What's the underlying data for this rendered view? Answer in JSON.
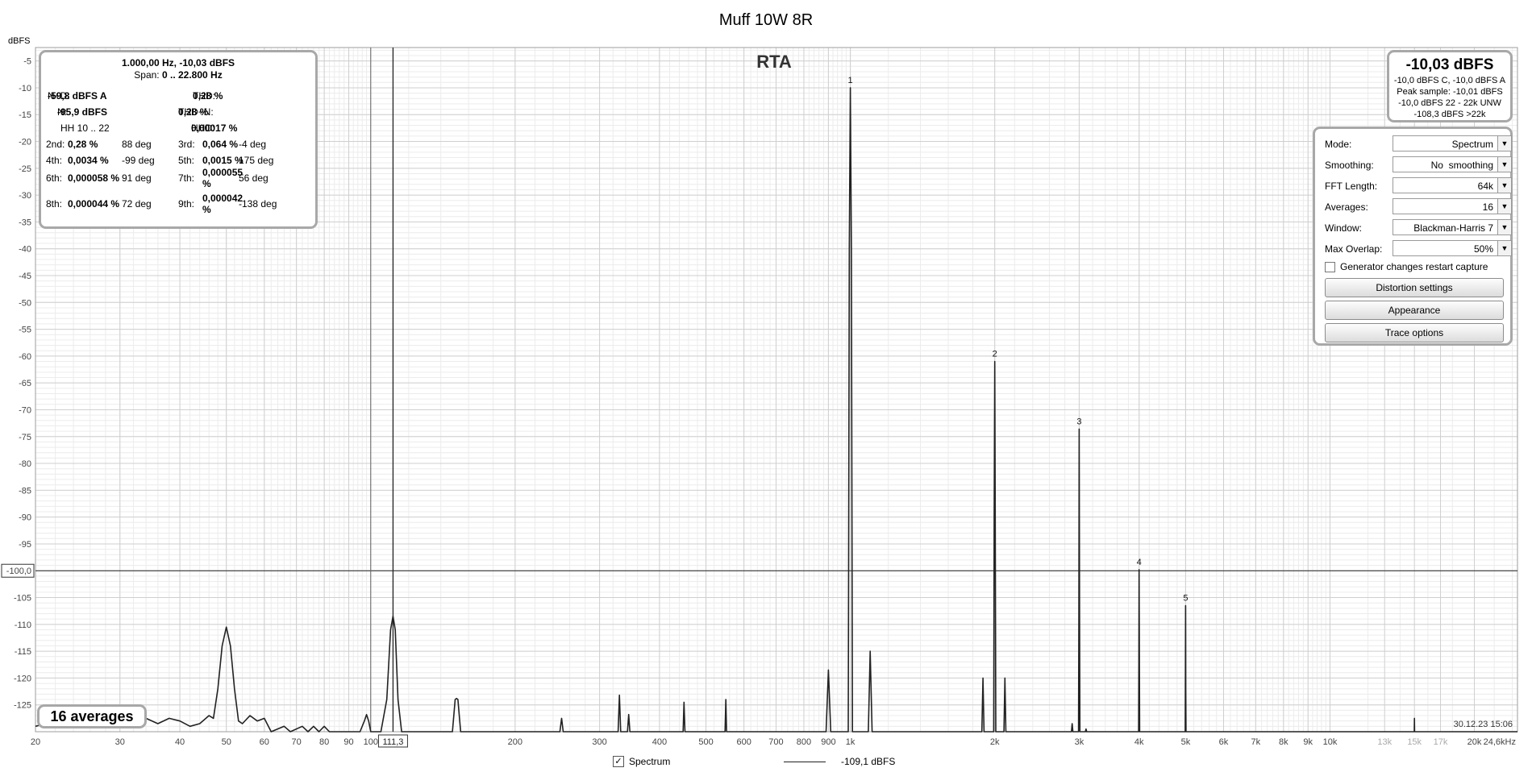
{
  "chart_data": {
    "type": "line",
    "title": "Muff 10W 8R",
    "inner_title": "RTA",
    "ylabel": "dBFS",
    "xscale": "log",
    "xlim": [
      20,
      24600
    ],
    "ylim": [
      -130,
      -2.5
    ],
    "grid": true,
    "y_ticks": [
      "-5",
      "-10",
      "-15",
      "-20",
      "-25",
      "-30",
      "-35",
      "-40",
      "-45",
      "-50",
      "-55",
      "-60",
      "-65",
      "-70",
      "-75",
      "-80",
      "-85",
      "-90",
      "-95",
      "-100,0",
      "-105",
      "-110",
      "-115",
      "-120",
      "-125"
    ],
    "y_tick_values": [
      -5,
      -10,
      -15,
      -20,
      -25,
      -30,
      -35,
      -40,
      -45,
      -50,
      -55,
      -60,
      -65,
      -70,
      -75,
      -80,
      -85,
      -90,
      -95,
      -100,
      -105,
      -110,
      -115,
      -120,
      -125
    ],
    "x_ticks": [
      {
        "f": 20,
        "label": "20"
      },
      {
        "f": 30,
        "label": "30"
      },
      {
        "f": 40,
        "label": "40"
      },
      {
        "f": 50,
        "label": "50"
      },
      {
        "f": 60,
        "label": "60"
      },
      {
        "f": 70,
        "label": "70"
      },
      {
        "f": 80,
        "label": "80"
      },
      {
        "f": 90,
        "label": "90"
      },
      {
        "f": 100,
        "label": "100"
      },
      {
        "f": 200,
        "label": "200"
      },
      {
        "f": 300,
        "label": "300"
      },
      {
        "f": 400,
        "label": "400"
      },
      {
        "f": 500,
        "label": "500"
      },
      {
        "f": 600,
        "label": "600"
      },
      {
        "f": 700,
        "label": "700"
      },
      {
        "f": 800,
        "label": "800"
      },
      {
        "f": 900,
        "label": "900"
      },
      {
        "f": 1000,
        "label": "1k"
      },
      {
        "f": 2000,
        "label": "2k"
      },
      {
        "f": 3000,
        "label": "3k"
      },
      {
        "f": 4000,
        "label": "4k"
      },
      {
        "f": 5000,
        "label": "5k"
      },
      {
        "f": 6000,
        "label": "6k"
      },
      {
        "f": 7000,
        "label": "7k"
      },
      {
        "f": 8000,
        "label": "8k"
      },
      {
        "f": 9000,
        "label": "9k"
      },
      {
        "f": 10000,
        "label": "10k"
      },
      {
        "f": 13000,
        "label": "13k",
        "faded": true
      },
      {
        "f": 15000,
        "label": "15k",
        "faded": true
      },
      {
        "f": 17000,
        "label": "17k",
        "faded": true
      },
      {
        "f": 20000,
        "label": "20k"
      },
      {
        "f": 24600,
        "label": "24,6kHz"
      }
    ],
    "cursor": {
      "x_label": "111,3",
      "x_value": 111.3,
      "y_label": "-100,0",
      "y_value": -100
    },
    "marker_line_hz": 100,
    "harmonic_markers": [
      {
        "label": "1",
        "f": 1000,
        "db": -10.0
      },
      {
        "label": "2",
        "f": 2000,
        "db": -61.0
      },
      {
        "label": "3",
        "f": 3000,
        "db": -73.6
      },
      {
        "label": "4",
        "f": 4000,
        "db": -99.8
      },
      {
        "label": "5",
        "f": 5000,
        "db": -106.5
      }
    ],
    "series": [
      {
        "name": "Spectrum",
        "legend_value": "-109,1 dBFS",
        "color": "#222222",
        "points": [
          [
            20,
            -129
          ],
          [
            22,
            -128
          ],
          [
            24,
            -129
          ],
          [
            26,
            -127
          ],
          [
            28,
            -128
          ],
          [
            30,
            -126
          ],
          [
            32,
            -129
          ],
          [
            34,
            -127.5
          ],
          [
            36,
            -128.5
          ],
          [
            38,
            -127.5
          ],
          [
            40,
            -128
          ],
          [
            42,
            -129
          ],
          [
            44,
            -128.5
          ],
          [
            46,
            -127
          ],
          [
            47,
            -127.5
          ],
          [
            48,
            -122
          ],
          [
            49,
            -114
          ],
          [
            50,
            -110.5
          ],
          [
            51,
            -114
          ],
          [
            52,
            -122
          ],
          [
            53,
            -128
          ],
          [
            54,
            -128.5
          ],
          [
            56,
            -127
          ],
          [
            58,
            -128
          ],
          [
            60,
            -127.5
          ],
          [
            62,
            -130
          ],
          [
            66,
            -129
          ],
          [
            68,
            -130
          ],
          [
            72,
            -129
          ],
          [
            74,
            -130
          ],
          [
            76,
            -129
          ],
          [
            78,
            -130
          ],
          [
            80,
            -129
          ],
          [
            82,
            -130
          ],
          [
            95,
            -130
          ],
          [
            97,
            -128
          ],
          [
            98,
            -126.8
          ],
          [
            99,
            -128
          ],
          [
            100,
            -130
          ],
          [
            105,
            -130
          ],
          [
            108,
            -124
          ],
          [
            110,
            -111
          ],
          [
            111.3,
            -108.5
          ],
          [
            112.5,
            -111
          ],
          [
            114,
            -124
          ],
          [
            116,
            -130
          ],
          [
            148,
            -130
          ],
          [
            150,
            -124
          ],
          [
            151,
            -123.8
          ],
          [
            152,
            -124
          ],
          [
            154,
            -130
          ],
          [
            248,
            -130
          ],
          [
            250,
            -127.5
          ],
          [
            252,
            -130
          ],
          [
            328,
            -130
          ],
          [
            330,
            -123.2
          ],
          [
            332,
            -130
          ],
          [
            343,
            -130
          ],
          [
            345,
            -126.8
          ],
          [
            347,
            -130
          ],
          [
            448,
            -130
          ],
          [
            450,
            -124.5
          ],
          [
            452,
            -130
          ],
          [
            548,
            -130
          ],
          [
            550,
            -124
          ],
          [
            552,
            -130
          ],
          [
            890,
            -130
          ],
          [
            900,
            -118.5
          ],
          [
            910,
            -130
          ],
          [
            990,
            -130
          ],
          [
            995,
            -40
          ],
          [
            1000,
            -10
          ],
          [
            1005,
            -40
          ],
          [
            1010,
            -130
          ],
          [
            1090,
            -130
          ],
          [
            1100,
            -115
          ],
          [
            1110,
            -130
          ],
          [
            1880,
            -130
          ],
          [
            1890,
            -120
          ],
          [
            1900,
            -130
          ],
          [
            1990,
            -130
          ],
          [
            1995,
            -90
          ],
          [
            2000,
            -61
          ],
          [
            2005,
            -90
          ],
          [
            2010,
            -130
          ],
          [
            2090,
            -130
          ],
          [
            2100,
            -120
          ],
          [
            2110,
            -130
          ],
          [
            2890,
            -130
          ],
          [
            2900,
            -128.5
          ],
          [
            2910,
            -130
          ],
          [
            2990,
            -130
          ],
          [
            2995,
            -110
          ],
          [
            3000,
            -73.6
          ],
          [
            3005,
            -110
          ],
          [
            3010,
            -130
          ],
          [
            3090,
            -130
          ],
          [
            3100,
            -129.5
          ],
          [
            3110,
            -130
          ],
          [
            3990,
            -130
          ],
          [
            3995,
            -118
          ],
          [
            4000,
            -99.8
          ],
          [
            4005,
            -118
          ],
          [
            4010,
            -130
          ],
          [
            4990,
            -130
          ],
          [
            4995,
            -122
          ],
          [
            5000,
            -106.5
          ],
          [
            5005,
            -122
          ],
          [
            5010,
            -130
          ],
          [
            14990,
            -130
          ],
          [
            15000,
            -127.5
          ],
          [
            15010,
            -130
          ],
          [
            24600,
            -130
          ]
        ]
      }
    ]
  },
  "distortion_panel": {
    "header_line1": "1.000,00 Hz, -10,03 dBFS",
    "span_label": "Span:",
    "span_value": "0 .. 22.800 Hz",
    "nd_label": "N+D:",
    "nd_value": "-59,8 dBFS A",
    "thd_label": "THD:",
    "thd_value": "0,28 %",
    "n_label": "N:",
    "n_value": "-95,9 dBFS",
    "thdn_label": "THD+N:",
    "thdn_value": "0,28 %",
    "hh_label": "HH 10 .. 22",
    "hhd_label": "HHD:",
    "hhd_value": "0,00017 %",
    "harmonics": [
      {
        "label": "2nd:",
        "value": "0,28 %",
        "phase": "88 deg"
      },
      {
        "label": "3rd:",
        "value": "0,064 %",
        "phase": "-4 deg"
      },
      {
        "label": "4th:",
        "value": "0,0034 %",
        "phase": "-99 deg"
      },
      {
        "label": "5th:",
        "value": "0,0015 %",
        "phase": "175 deg"
      },
      {
        "label": "6th:",
        "value": "0,000058 %",
        "phase": "91 deg"
      },
      {
        "label": "7th:",
        "value": "0,000055 %",
        "phase": "56 deg"
      },
      {
        "label": "8th:",
        "value": "0,000044 %",
        "phase": "72 deg"
      },
      {
        "label": "9th:",
        "value": "0,000042 %",
        "phase": "-138 deg"
      }
    ]
  },
  "level_panel": {
    "main": "-10,03 dBFS",
    "line1": "-10,0 dBFS C, -10,0 dBFS A",
    "line2": "Peak sample: -10,01 dBFS",
    "line3": "-10,0 dBFS 22 - 22k UNW",
    "line4": "-108,3 dBFS >22k"
  },
  "controls": {
    "mode": {
      "label": "Mode:",
      "value": "Spectrum"
    },
    "smoothing": {
      "label": "Smoothing:",
      "value": "No  smoothing"
    },
    "fft_length": {
      "label": "FFT Length:",
      "value": "64k"
    },
    "averages": {
      "label": "Averages:",
      "value": "16"
    },
    "window": {
      "label": "Window:",
      "value": "Blackman-Harris 7"
    },
    "max_overlap": {
      "label": "Max Overlap:",
      "value": "50%"
    },
    "generator_checkbox": {
      "label": "Generator changes restart capture",
      "checked": false
    },
    "distortion_button": "Distortion settings",
    "appearance_button": "Appearance",
    "trace_button": "Trace options"
  },
  "averages_badge": "16 averages",
  "timestamp": "30.12.23 15:06",
  "legend": {
    "checked": true,
    "check_glyph": "✓",
    "name": "Spectrum",
    "value": "-109,1 dBFS"
  }
}
